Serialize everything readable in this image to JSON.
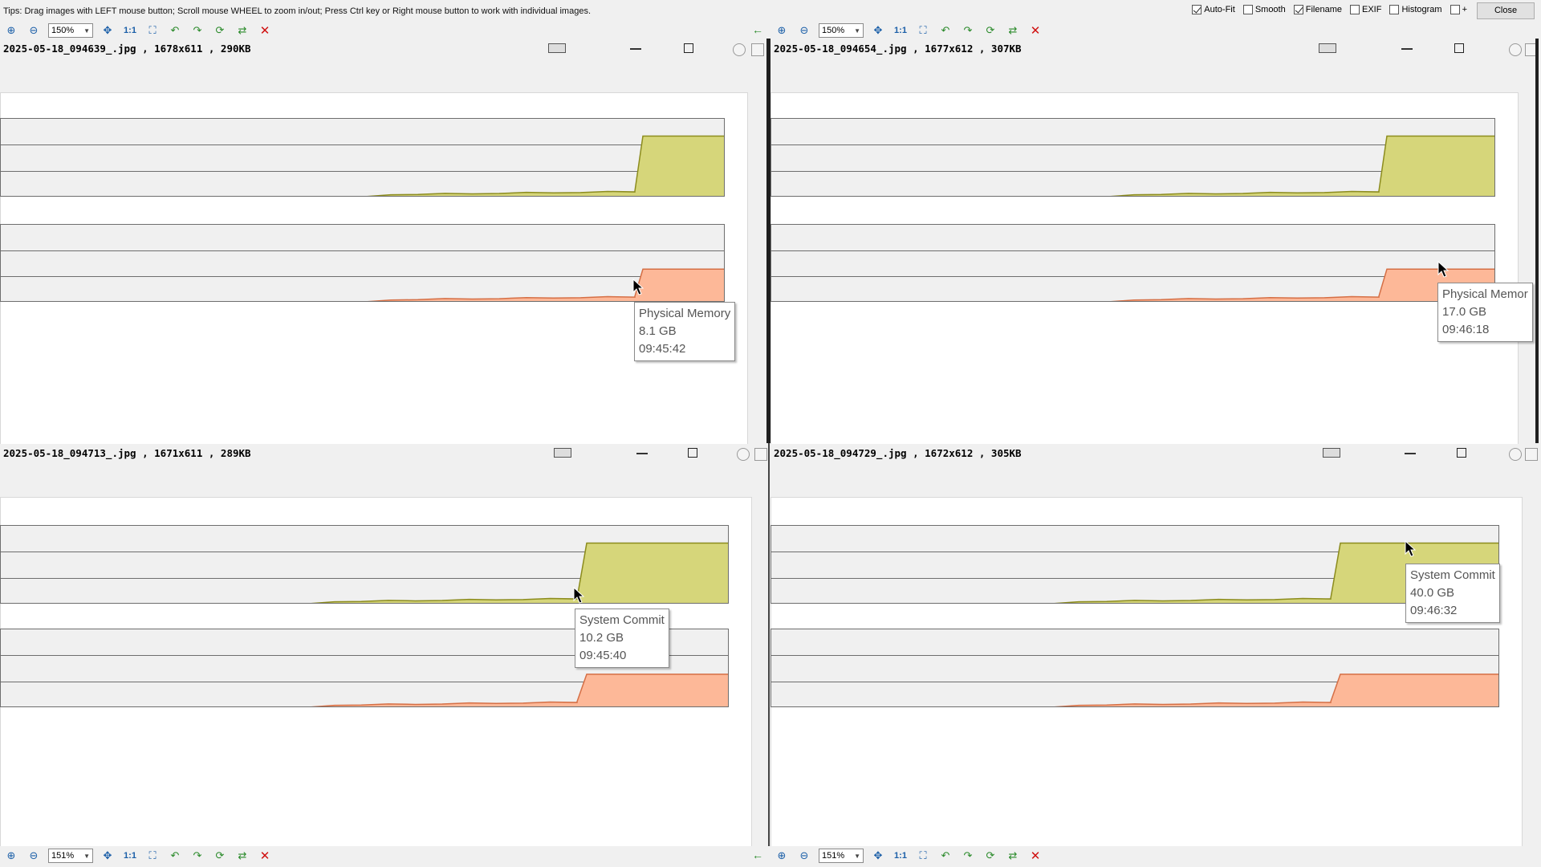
{
  "app": {
    "tips": "Tips: Drag images with LEFT mouse button; Scroll mouse WHEEL to zoom in/out; Press Ctrl key or Right mouse button to work with individual images.",
    "options": [
      {
        "label": "Auto-Fit",
        "checked": true
      },
      {
        "label": "Smooth",
        "checked": false
      },
      {
        "label": "Filename",
        "checked": true
      },
      {
        "label": "EXIF",
        "checked": false
      },
      {
        "label": "Histogram",
        "checked": false
      },
      {
        "label": "+",
        "checked": false
      }
    ],
    "close_label": "Close"
  },
  "toolbars": {
    "top_zoom": "150%",
    "bottom_zoom": "151%",
    "one_to_one": "1:1",
    "icons": [
      "zoom-in-icon",
      "zoom-out-icon",
      "move-icon",
      "fit-icon",
      "rotate-left-icon",
      "rotate-right-icon",
      "sync-icon",
      "save-icon",
      "close-x-icon"
    ],
    "back_arrow": "←"
  },
  "panes": [
    {
      "title": "2025-05-18_094639_.jpg , 1678x611 , 290KB",
      "tooltip": {
        "line1": "Physical Memory",
        "line2": "8.1 GB",
        "line3": "09:45:42"
      }
    },
    {
      "title": "2025-05-18_094654_.jpg , 1677x612 , 307KB",
      "tooltip": {
        "line1": "Physical Memor",
        "line2": "17.0 GB",
        "line3": "09:46:18"
      }
    },
    {
      "title": "2025-05-18_094713_.jpg , 1671x611 , 289KB",
      "tooltip": {
        "line1": "System Commit",
        "line2": "10.2 GB",
        "line3": "09:45:40"
      }
    },
    {
      "title": "2025-05-18_094729_.jpg , 1672x612 , 305KB",
      "tooltip": {
        "line1": "System Commit",
        "line2": "40.0 GB",
        "line3": "09:46:32"
      }
    }
  ],
  "colors": {
    "commit_fill": "#d6d67a",
    "commit_stroke": "#8c8c1e",
    "memory_fill": "#fdb898",
    "memory_stroke": "#d56f45",
    "close_x": "#d01010"
  }
}
